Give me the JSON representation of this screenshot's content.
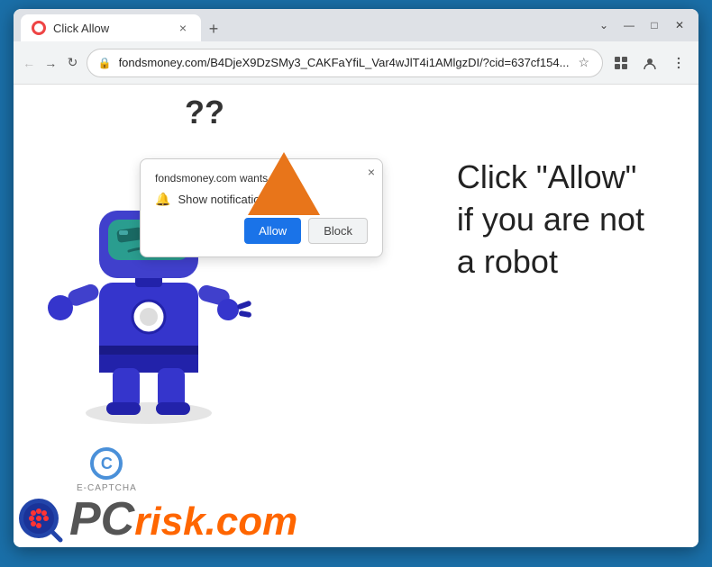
{
  "browser": {
    "title": "Click Allow",
    "url": "fondsmoney.com/B4DjeX9DzSMy3_CAKFaYfiL_Var4wJlT4i1AMlgzDI/?cid=637cf154...",
    "tab_close": "×",
    "new_tab": "+",
    "win_minimize": "—",
    "win_restore": "□",
    "win_close": "✕",
    "nav_back": "←",
    "nav_forward": "→",
    "nav_refresh": "↻"
  },
  "popup": {
    "site_text": "fondsmoney.com wants to...",
    "close": "×",
    "notification_label": "Show notifications",
    "allow_btn": "Allow",
    "block_btn": "Block"
  },
  "page": {
    "question_marks": "??",
    "main_text_line1": "Click \"Allow\"",
    "main_text_line2": "if you are not",
    "main_text_line3": "a robot"
  },
  "ecaptcha": {
    "c_letter": "C",
    "label": "E-CAPTCHA"
  },
  "pcrisk": {
    "pc": "PC",
    "risk": "risk",
    "dot": ".",
    "com": "com"
  },
  "colors": {
    "robot_blue": "#4040cc",
    "robot_head_teal": "#2a9d8f",
    "accent_orange": "#ff6600",
    "browser_border": "#1a6fa8"
  }
}
